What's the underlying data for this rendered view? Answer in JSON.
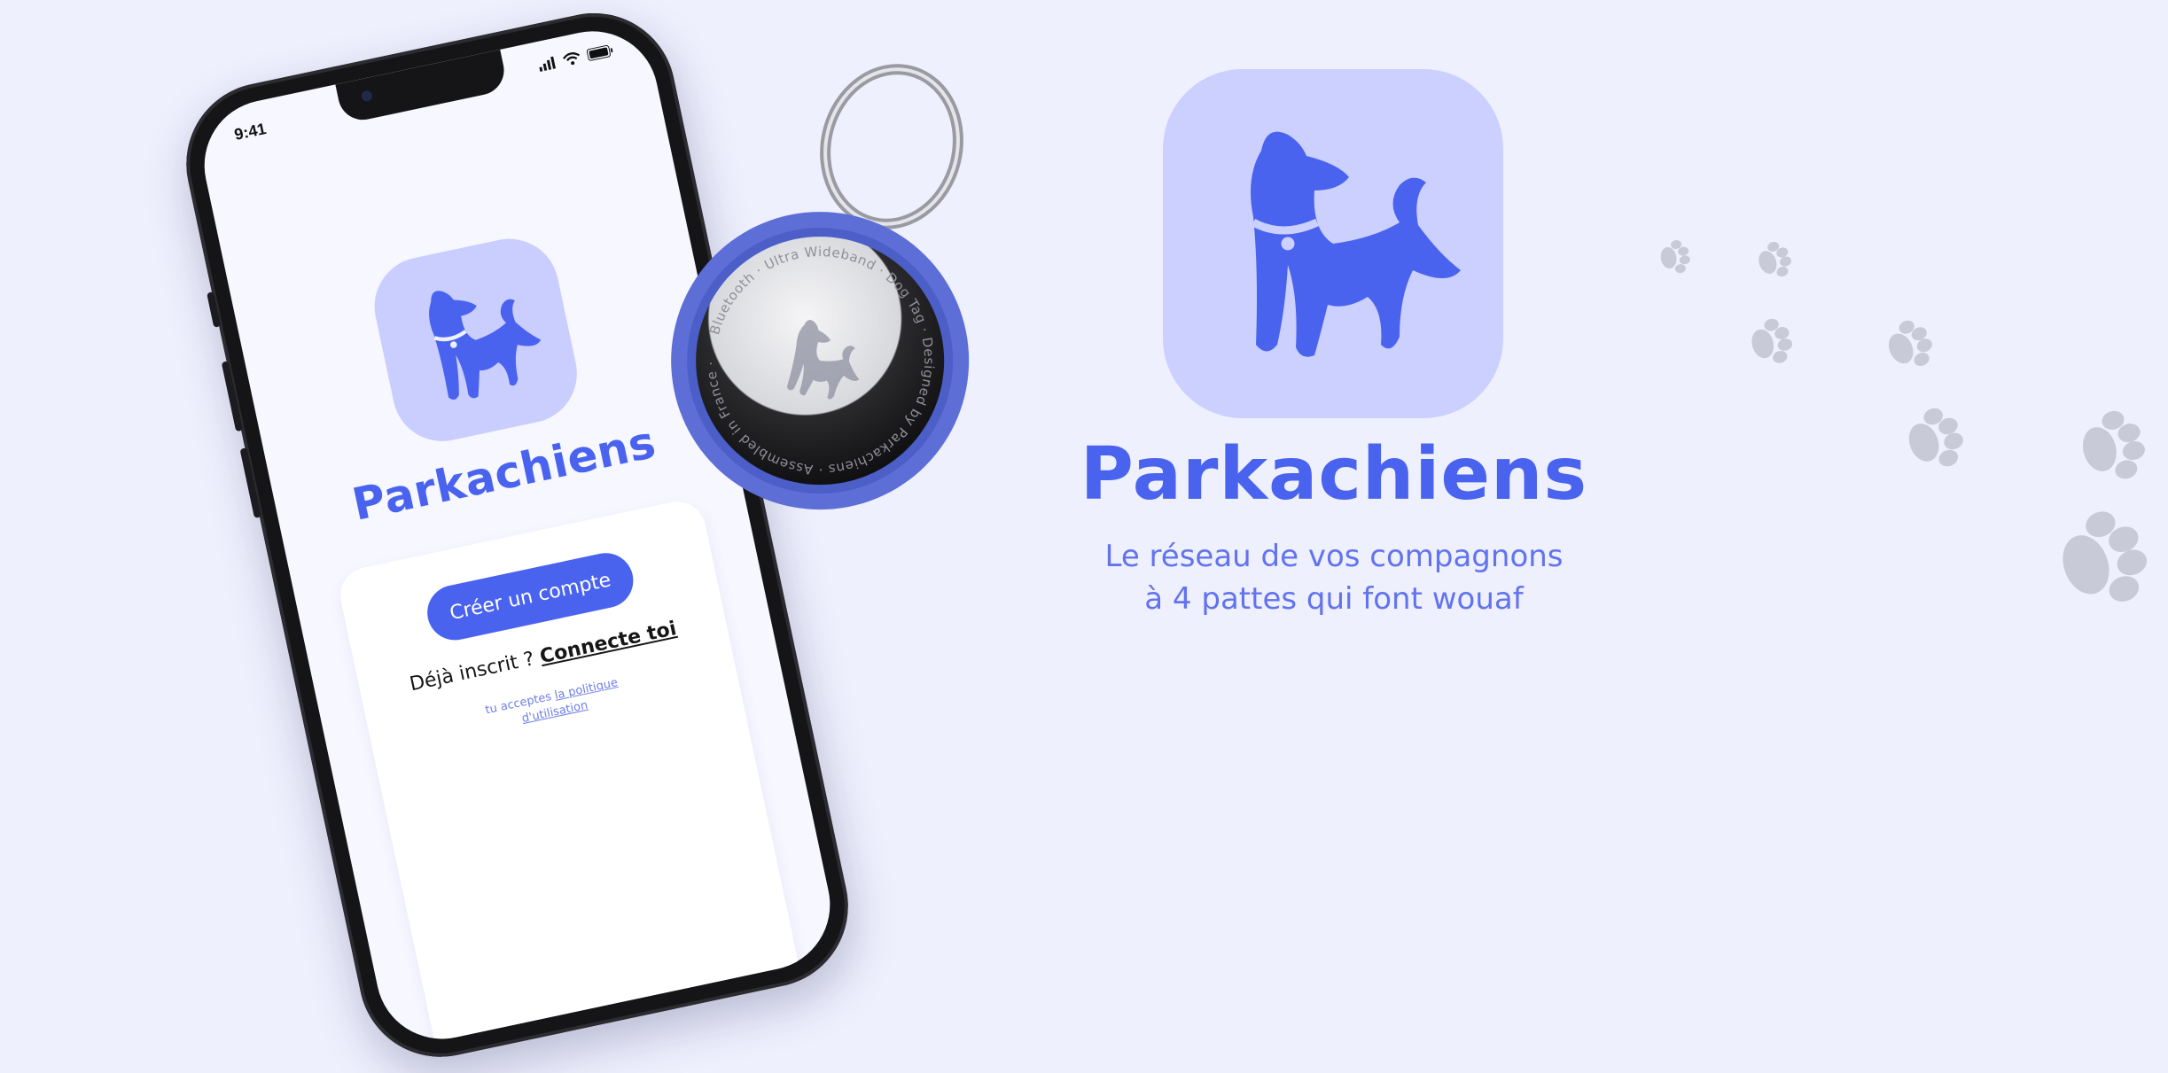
{
  "brand": {
    "name": "Parkachiens",
    "tagline_line1": "Le réseau de vos compagnons",
    "tagline_line2": "à 4 pattes qui font wouaf"
  },
  "phone": {
    "status_time": "9:41",
    "app_name": "Parkachiens",
    "cta_label": "Créer un compte",
    "login_prompt": "Déjà inscrit ?",
    "login_link": "Connecte toi",
    "legal_prefix": "tu acceptes",
    "legal_link1": "la politique",
    "legal_link2": "d'utilisation"
  },
  "tag": {
    "ring_text": "Bluetooth · Ultra Wideband · Dog Tag · Designed by Parkachiens · Assembled in France ·"
  },
  "colors": {
    "background": "#eef0fe",
    "accent": "#4a63ef",
    "icon_bg": "#cbd0ff",
    "paw": "#c5c8d6",
    "tag_case": "#5d6fd6"
  },
  "icons": [
    "dog-logo-icon",
    "signal-icon",
    "wifi-icon",
    "battery-icon",
    "paw-print-icon",
    "keyring-icon"
  ]
}
